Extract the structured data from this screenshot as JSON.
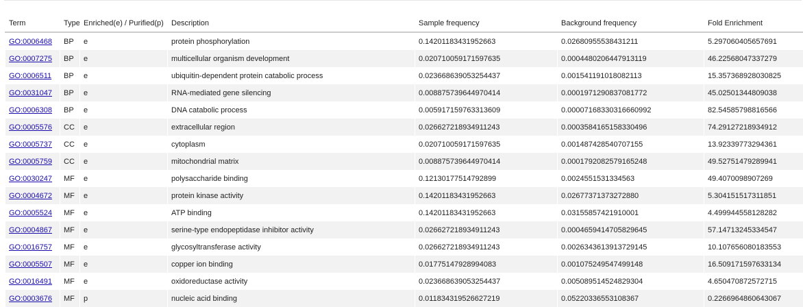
{
  "columns": {
    "term": "Term",
    "type": "Type",
    "enriched": "Enriched(e) / Purified(p)",
    "description": "Description",
    "sample_freq": "Sample frequency",
    "background_freq": "Background frequency",
    "fold": "Fold Enrichment"
  },
  "rows": [
    {
      "term": "GO:0006468",
      "type": "BP",
      "ep": "e",
      "description": "protein phosphorylation",
      "sample": "0.14201183431952663",
      "background": "0.02680955538431211",
      "fold": "5.297060405657691"
    },
    {
      "term": "GO:0007275",
      "type": "BP",
      "ep": "e",
      "description": "multicellular organism development",
      "sample": "0.020710059171597635",
      "background": "0.0004480206447913119",
      "fold": "46.22568047337279"
    },
    {
      "term": "GO:0006511",
      "type": "BP",
      "ep": "e",
      "description": "ubiquitin-dependent protein catabolic process",
      "sample": "0.023668639053254437",
      "background": "0.001541191018082113",
      "fold": "15.357368928030825"
    },
    {
      "term": "GO:0031047",
      "type": "BP",
      "ep": "e",
      "description": "RNA-mediated gene silencing",
      "sample": "0.008875739644970414",
      "background": "0.0001971290837081772",
      "fold": "45.02501344809038"
    },
    {
      "term": "GO:0006308",
      "type": "BP",
      "ep": "e",
      "description": "DNA catabolic process",
      "sample": "0.005917159763313609",
      "background": "0.00007168330316660992",
      "fold": "82.54585798816566"
    },
    {
      "term": "GO:0005576",
      "type": "CC",
      "ep": "e",
      "description": "extracellular region",
      "sample": "0.026627218934911243",
      "background": "0.0003584165158330496",
      "fold": "74.29127218934912"
    },
    {
      "term": "GO:0005737",
      "type": "CC",
      "ep": "e",
      "description": "cytoplasm",
      "sample": "0.020710059171597635",
      "background": "0.001487428540707155",
      "fold": "13.92339773294361"
    },
    {
      "term": "GO:0005759",
      "type": "CC",
      "ep": "e",
      "description": "mitochondrial matrix",
      "sample": "0.008875739644970414",
      "background": "0.0001792082579165248",
      "fold": "49.52751479289941"
    },
    {
      "term": "GO:0030247",
      "type": "MF",
      "ep": "e",
      "description": "polysaccharide binding",
      "sample": "0.12130177514792899",
      "background": "0.0024551531334563",
      "fold": "49.4070098907269"
    },
    {
      "term": "GO:0004672",
      "type": "MF",
      "ep": "e",
      "description": "protein kinase activity",
      "sample": "0.14201183431952663",
      "background": "0.02677371373272880",
      "fold": "5.304151517311851"
    },
    {
      "term": "GO:0005524",
      "type": "MF",
      "ep": "e",
      "description": "ATP binding",
      "sample": "0.14201183431952663",
      "background": "0.03155857421910001",
      "fold": "4.499944558128282"
    },
    {
      "term": "GO:0004867",
      "type": "MF",
      "ep": "e",
      "description": "serine-type endopeptidase inhibitor activity",
      "sample": "0.026627218934911243",
      "background": "0.0004659414705829645",
      "fold": "57.14713245334547"
    },
    {
      "term": "GO:0016757",
      "type": "MF",
      "ep": "e",
      "description": "glycosyltransferase activity",
      "sample": "0.026627218934911243",
      "background": "0.0026343613913729145",
      "fold": "10.107656080183553"
    },
    {
      "term": "GO:0005507",
      "type": "MF",
      "ep": "e",
      "description": "copper ion binding",
      "sample": "0.01775147928994083",
      "background": "0.001075249547499148",
      "fold": "16.509171597633134"
    },
    {
      "term": "GO:0016491",
      "type": "MF",
      "ep": "e",
      "description": "oxidoreductase activity",
      "sample": "0.023668639053254437",
      "background": "0.005089514524829304",
      "fold": "4.650470872572715"
    },
    {
      "term": "GO:0003676",
      "type": "MF",
      "ep": "p",
      "description": "nucleic acid binding",
      "sample": "0.011834319526627219",
      "background": "0.05220336553108367",
      "fold": "0.2266964860643067"
    }
  ]
}
